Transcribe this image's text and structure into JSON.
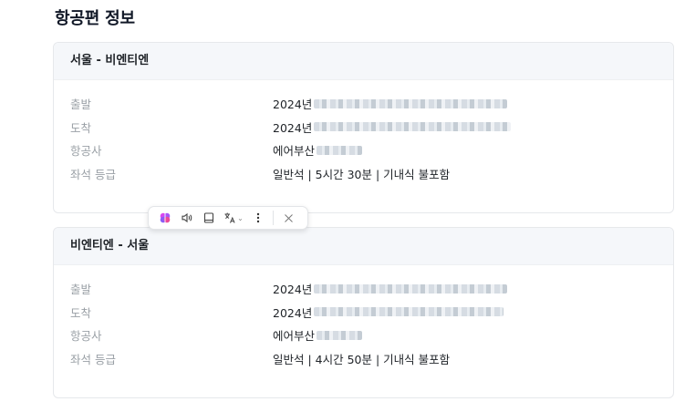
{
  "section": {
    "title": "항공편 정보"
  },
  "flights": [
    {
      "route": "서울 - 비엔티엔",
      "rows": [
        {
          "label": "출발",
          "value": "2024년"
        },
        {
          "label": "도착",
          "value": "2024년"
        },
        {
          "label": "항공사",
          "value": "에어부산"
        },
        {
          "label": "좌석 등급",
          "value": "일반석 | 5시간 30분 | 기내식 불포함"
        }
      ]
    },
    {
      "route": "비엔티엔 - 서울",
      "rows": [
        {
          "label": "출발",
          "value": "2024년"
        },
        {
          "label": "도착",
          "value": "2024년"
        },
        {
          "label": "항공사",
          "value": "에어부산"
        },
        {
          "label": "좌석 등급",
          "value": "일반석 | 4시간 50분 | 기내식 불포함"
        }
      ]
    }
  ],
  "toolbar": {
    "icons": [
      "brain-icon",
      "speaker-icon",
      "book-icon",
      "translate-icon",
      "more-icon",
      "close-icon"
    ],
    "brand_color": "#c026d3"
  }
}
